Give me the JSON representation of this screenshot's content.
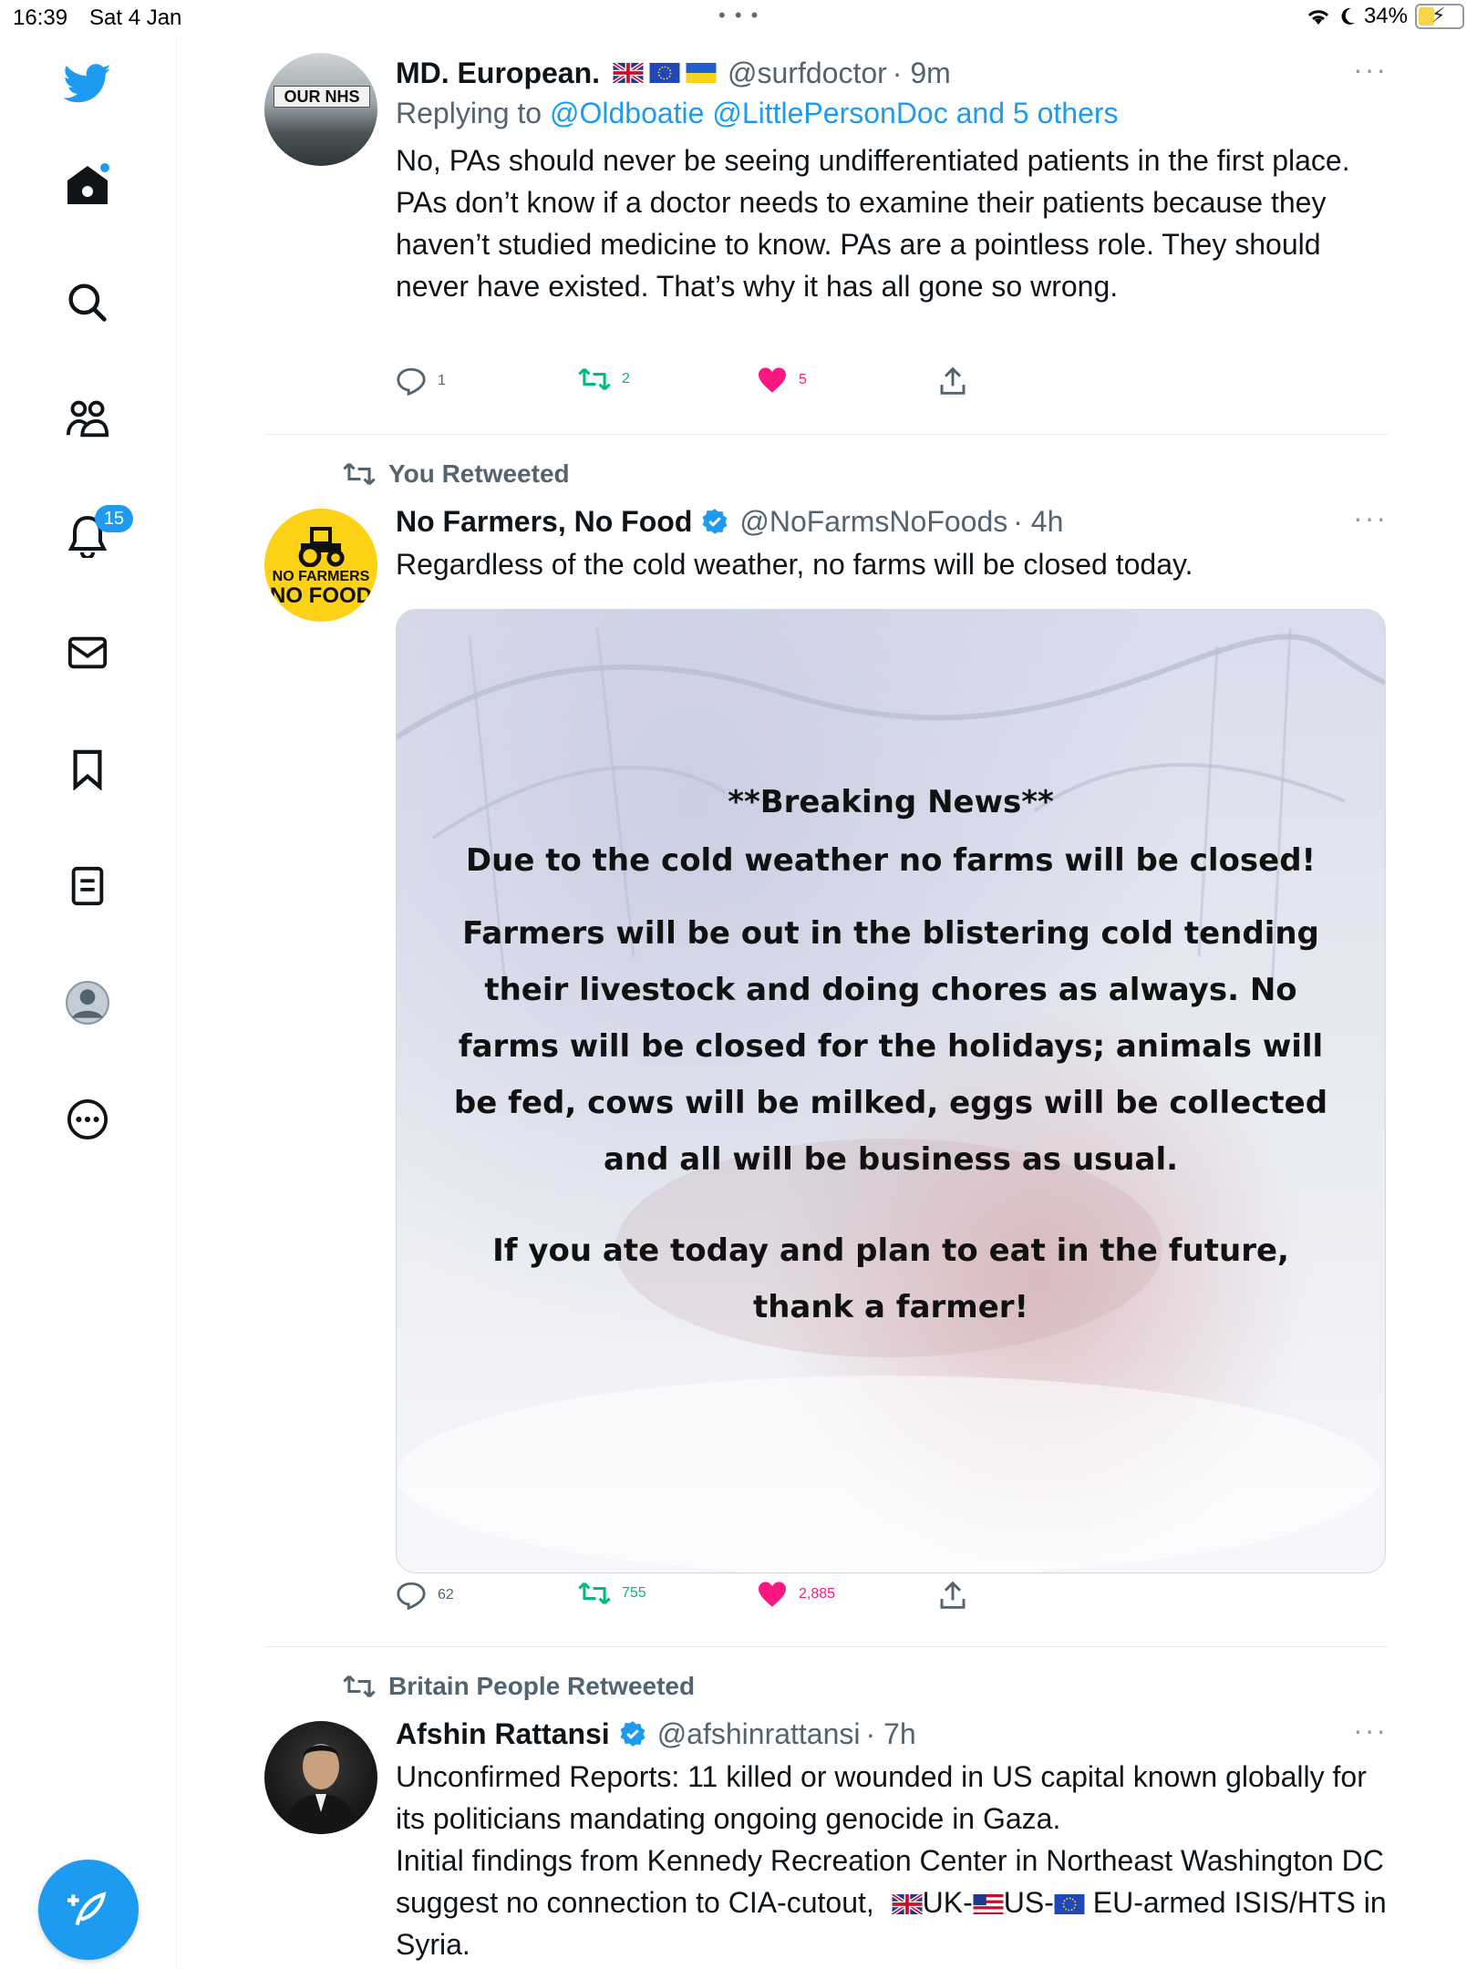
{
  "status": {
    "time": "16:39",
    "date": "Sat 4 Jan",
    "battery": "34%"
  },
  "sidebar": {
    "notifications_badge": "15"
  },
  "tweets": [
    {
      "name": "MD. European.",
      "handle": "@surfdoctor",
      "time": "· 9m",
      "avatar_text": "OUR NHS",
      "reply_prefix": "Replying to ",
      "reply_links": "@Oldboatie @LittlePersonDoc and 5 others",
      "text": "No, PAs should never be seeing undifferentiated patients in the first place. PAs don’t know if a doctor needs to examine their patients because they haven’t studied medicine to know. PAs are a pointless role. They should never have existed. That’s why it has all gone so wrong.",
      "replies": "1",
      "retweets": "2",
      "likes": "5"
    },
    {
      "retweeted_by": "You Retweeted",
      "name": "No Farmers, No Food",
      "handle": "@NoFarmsNoFoods",
      "time": "· 4h",
      "avatar_line1": "NO FARMERS",
      "avatar_line2": "NO FOOD",
      "text": "Regardless of the cold weather, no farms will be closed today.",
      "media": {
        "line1": "**Breaking News**",
        "line2": "Due to the cold weather no farms will be closed!",
        "para": "Farmers will be out in the blistering cold tending their livestock and doing chores as always. No farms will be closed for the holidays; animals will be fed, cows will be milked, eggs will be collected and all will be business as usual.",
        "closing": "If you ate today and plan to eat in the future, thank a farmer!"
      },
      "replies": "62",
      "retweets": "755",
      "likes": "2,885"
    },
    {
      "retweeted_by": "Britain People Retweeted",
      "name": "Afshin Rattansi",
      "handle": "@afshinrattansi",
      "time": "· 7h",
      "text1": "Unconfirmed Reports: 11 killed or wounded in US capital known globally for its politicians mandating ongoing genocide in Gaza.",
      "text2_a": "Initial findings from Kennedy Recreation Center in Northeast Washington DC suggest no connection to CIA-cutout,",
      "text2_b": "UK-",
      "text2_c": "US-",
      "text2_d": "EU-armed ISIS/HTS in Syria."
    }
  ],
  "colors": {
    "accent": "#1d9bf0",
    "retweet": "#00ba7c",
    "like": "#f91880"
  },
  "icons": [
    "twitter-bird-icon",
    "home-icon",
    "search-icon",
    "communities-icon",
    "notifications-icon",
    "messages-icon",
    "bookmarks-icon",
    "lists-icon",
    "profile-icon",
    "more-icon",
    "compose-icon"
  ]
}
